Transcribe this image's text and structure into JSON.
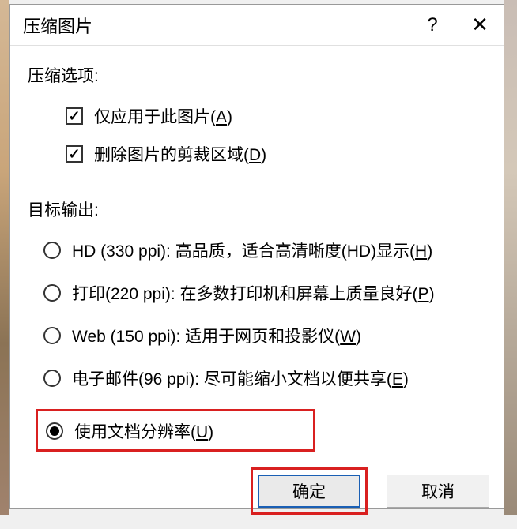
{
  "dialog": {
    "title": "压缩图片",
    "help_icon": "?",
    "close_icon": "✕"
  },
  "compression_section": {
    "heading": "压缩选项:",
    "options": [
      {
        "label": "仅应用于此图片(",
        "accel": "A",
        "tail": ")",
        "checked": true
      },
      {
        "label": "删除图片的剪裁区域(",
        "accel": "D",
        "tail": ")",
        "checked": true
      }
    ]
  },
  "output_section": {
    "heading": "目标输出:",
    "radios": [
      {
        "label": "HD (330 ppi): 高品质，适合高清晰度(HD)显示(",
        "accel": "H",
        "tail": ")",
        "selected": false
      },
      {
        "label": "打印(220 ppi): 在多数打印机和屏幕上质量良好(",
        "accel": "P",
        "tail": ")",
        "selected": false
      },
      {
        "label": "Web (150 ppi): 适用于网页和投影仪(",
        "accel": "W",
        "tail": ")",
        "selected": false
      },
      {
        "label": "电子邮件(96 ppi): 尽可能缩小文档以便共享(",
        "accel": "E",
        "tail": ")",
        "selected": false
      },
      {
        "label": "使用文档分辨率(",
        "accel": "U",
        "tail": ")",
        "selected": true,
        "highlighted": true
      }
    ]
  },
  "buttons": {
    "ok": "确定",
    "cancel": "取消"
  }
}
